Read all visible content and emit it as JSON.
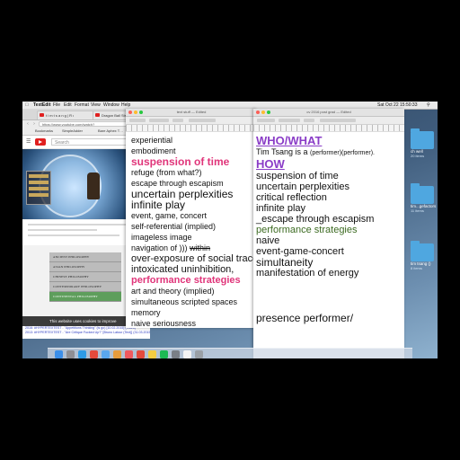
{
  "menubar": {
    "apple": "",
    "items": [
      "TextEdit",
      "File",
      "Edit",
      "Format",
      "View",
      "Window",
      "Help"
    ],
    "clock": "Sat Oct 22  15:50:33"
  },
  "browser": {
    "tabs": [
      "t i m t s a n g | R ı",
      "Dragon Ball Str…"
    ],
    "url": "https://www.youtube.com/watch?",
    "bookmarks": [
      "Bookmarks",
      "SimpleAdder",
      "Bare Aphex T…"
    ],
    "search_placeholder": "Search",
    "philosophy_header": "",
    "philosophy_items": [
      "ANCIENT PHILOSOPHY",
      "ASIAN PHILOSOPHY",
      "CHINESE PHILOSOPHY",
      "CONTEMPORARY PHILOSOPHY",
      "CONTINENTAL PHILOSOPHY"
    ],
    "cookie_text": "This website uses cookies to improve",
    "bottom_links": [
      "2016: #HYPERTEXTEST - \"Appetitions Thinking\" (is go) [10.02.2015] (Video)",
      "2013: #HYPERTEXTEST - \"Are Critique Fucked Up?\" [Bruno Latour (Text)] (31.03.2015) (Video)"
    ]
  },
  "doc1": {
    "title": "text stuff — Edited",
    "lines": [
      {
        "text": "experiential",
        "style": "s9"
      },
      {
        "text": "embodiment",
        "style": "s9"
      },
      {
        "text": "suspension of time",
        "style": "s12 pink"
      },
      {
        "text": "refuge (from what?)",
        "style": "s9"
      },
      {
        "text": "escape through escapism",
        "style": "s9"
      },
      {
        "text": "uncertain perplexities",
        "style": "s12"
      },
      {
        "text": "infinite play",
        "style": "s12"
      },
      {
        "text": "event, game, concert",
        "style": "s9"
      },
      {
        "text": "self-referential (implied)",
        "style": "s9"
      },
      {
        "text": "imageless image",
        "style": "s9"
      },
      {
        "text": "navigation of ))) within",
        "style": "s9"
      },
      {
        "text": "over-exposure of social trace",
        "style": "s11"
      },
      {
        "text": "intoxicated uninhibition,",
        "style": "s11"
      },
      {
        "text": "performance strategies",
        "style": "s11 pink"
      },
      {
        "text": "art and theory (implied)",
        "style": "s9"
      },
      {
        "text": "simultaneous scripted spaces",
        "style": "s9"
      },
      {
        "text": "memory",
        "style": "s9"
      },
      {
        "text": "naive seriousness",
        "style": "s9"
      }
    ]
  },
  "doc2": {
    "title": "cv 2016 post grad — Edited",
    "heading1": "WHO/WHAT",
    "who_line_1": "Tim Tsang is a ",
    "who_line_2": "(performer)(performer).",
    "heading2": "HOW",
    "lines": [
      {
        "text": "suspension of time",
        "style": "s11"
      },
      {
        "text": "uncertain perplexities",
        "style": "s11"
      },
      {
        "text": "critical reflection",
        "style": "s11"
      },
      {
        "text": "infinite play",
        "style": "s11"
      },
      {
        "text": "_escape through escapism",
        "style": "s11"
      },
      {
        "text": "performance strategies",
        "style": "s11 green"
      },
      {
        "text": "naive",
        "style": "s11"
      },
      {
        "text": "event-game-concert",
        "style": "s11"
      },
      {
        "text": "simultaneity",
        "style": "s12"
      },
      {
        "text": "manifestation of energy",
        "style": "s11"
      }
    ],
    "bottom_text": "presence performer/"
  },
  "desktop": [
    {
      "label": "ch well",
      "sub": "20 items"
    },
    {
      "label": "tim...gefactors",
      "sub": "11 items"
    },
    {
      "label": "tim tsang ()",
      "sub": "8 items"
    }
  ],
  "dock": [
    "Finder",
    "Launchpad",
    "Safari",
    "Chrome",
    "Mail",
    "Photos",
    "Music",
    "Calendar",
    "Notes",
    "Spotify",
    "System Preferences",
    "TextEdit",
    "Trash"
  ]
}
